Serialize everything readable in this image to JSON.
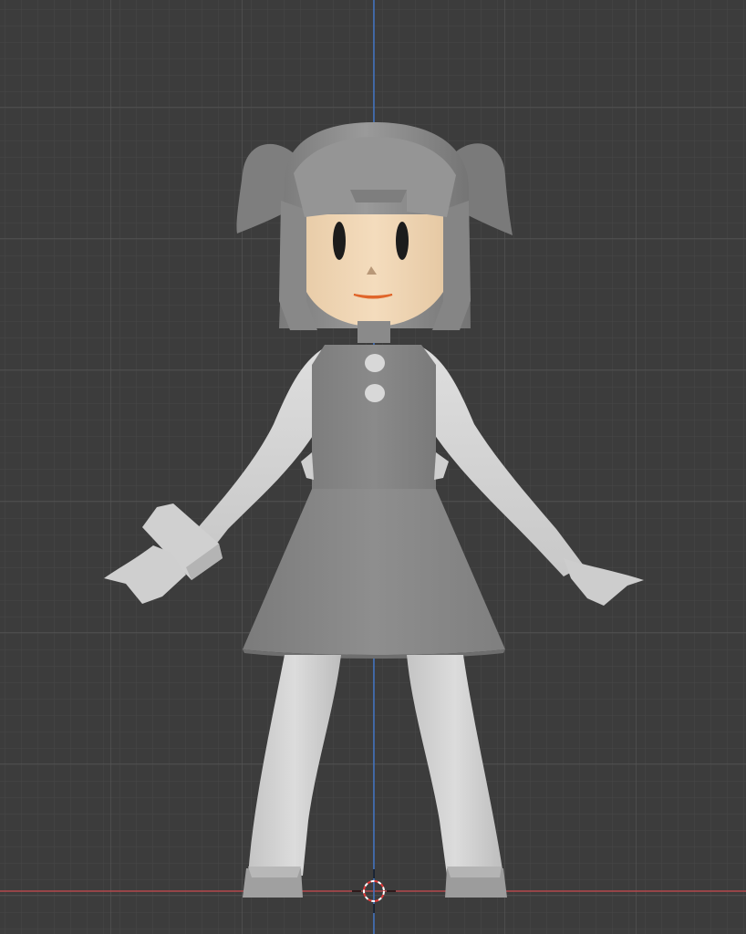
{
  "viewport": {
    "background_color": "#3c3c3c",
    "grid": {
      "visible": true,
      "minor_color": "#484848",
      "major_color": "#555555"
    },
    "axes": {
      "x_axis_color": "#b4484c",
      "z_axis_color": "#3f72c2"
    },
    "cursor_3d": {
      "icon": "3d-cursor-icon",
      "ring_colors": [
        "#e63a3a",
        "#ffffff"
      ]
    },
    "object": {
      "name": "character",
      "materials": {
        "hair": "#8c8c8c",
        "skin": "#f0d6b3",
        "dress": "#858585",
        "limbs": "#d6d6d6",
        "shoes": "#a0a0a0",
        "mouth": "#e0652a",
        "eyes": "#1c1c1c"
      }
    }
  }
}
